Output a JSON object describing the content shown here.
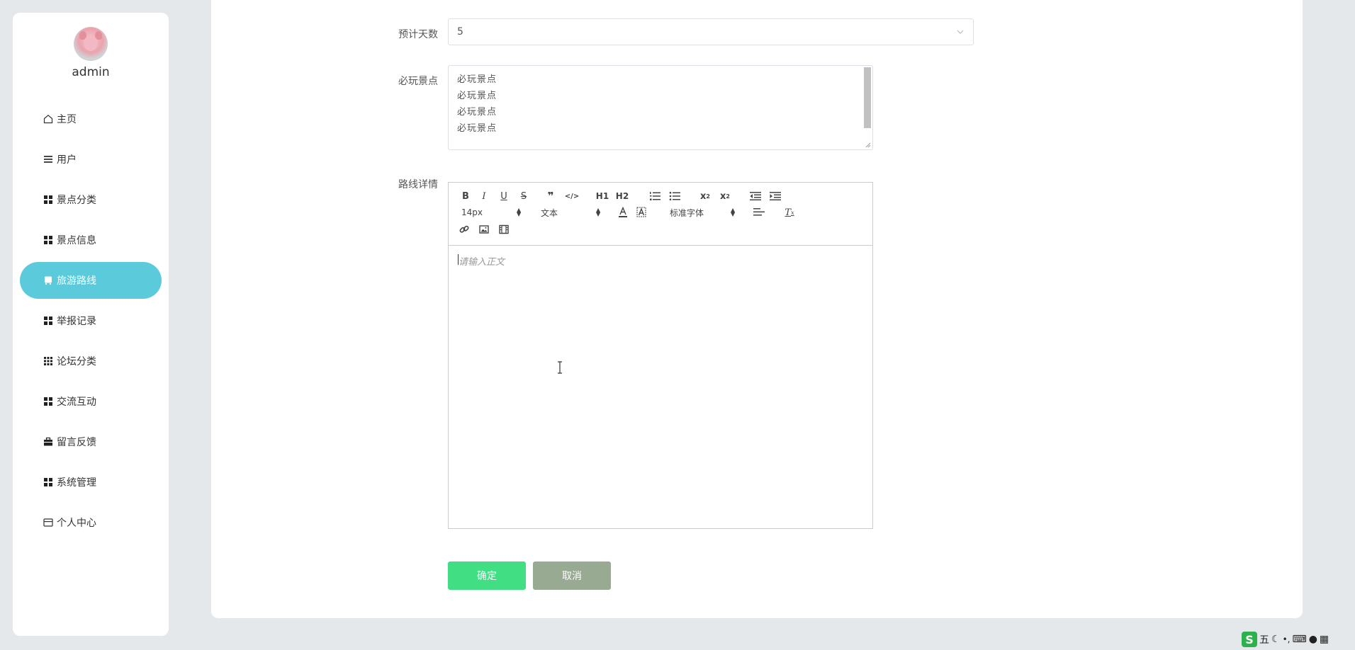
{
  "sidebar": {
    "username": "admin",
    "items": [
      {
        "label": "主页",
        "icon": "home-icon",
        "active": false
      },
      {
        "label": "用户",
        "icon": "list-icon",
        "active": false
      },
      {
        "label": "景点分类",
        "icon": "grid-icon",
        "active": false
      },
      {
        "label": "景点信息",
        "icon": "grid-icon",
        "active": false
      },
      {
        "label": "旅游路线",
        "icon": "bus-icon",
        "active": true
      },
      {
        "label": "举报记录",
        "icon": "grid-icon",
        "active": false
      },
      {
        "label": "论坛分类",
        "icon": "apps-icon",
        "active": false
      },
      {
        "label": "交流互动",
        "icon": "grid-icon",
        "active": false
      },
      {
        "label": "留言反馈",
        "icon": "briefcase-icon",
        "active": false
      },
      {
        "label": "系统管理",
        "icon": "grid-icon",
        "active": false
      },
      {
        "label": "个人中心",
        "icon": "card-icon",
        "active": false
      }
    ],
    "accent_color": "#5bcbdc"
  },
  "form": {
    "days_label": "预计天数",
    "days_value": "5",
    "spots_label": "必玩景点",
    "spots_lines": [
      "必玩景点",
      "必玩景点",
      "必玩景点",
      "必玩景点"
    ],
    "details_label": "路线详情",
    "editor": {
      "font_size": "14px",
      "block_type": "文本",
      "font_family": "标准字体",
      "placeholder": "请输入正文",
      "buttons": [
        "B",
        "I",
        "U",
        "S",
        "❞",
        "</>",
        "H1",
        "H2",
        "ordered-list",
        "bullet-list",
        "x2",
        "x2",
        "outdent",
        "indent",
        "A",
        "A",
        "align",
        "Tx",
        "link",
        "image",
        "video"
      ]
    },
    "ok_label": "确定",
    "cancel_label": "取消",
    "ok_color": "#42de83",
    "cancel_color": "#98aa92"
  },
  "tray": {
    "ime_label": "五"
  }
}
